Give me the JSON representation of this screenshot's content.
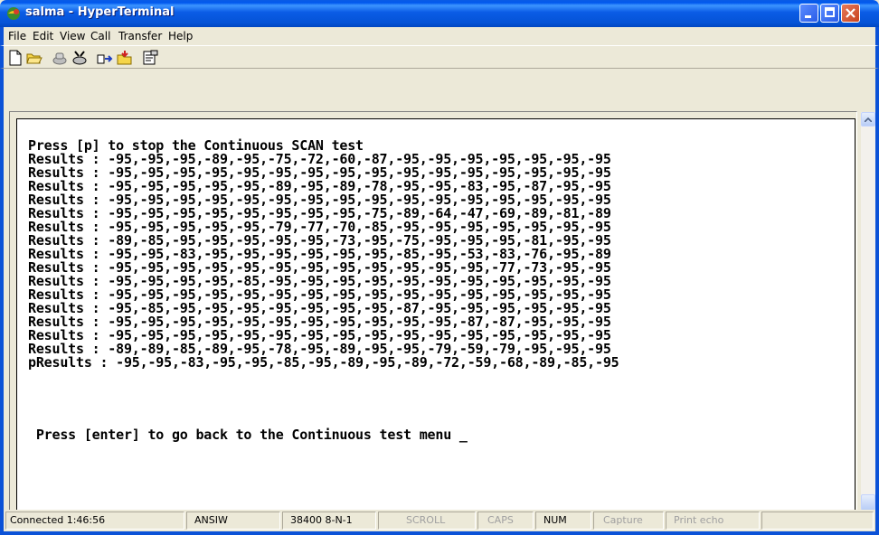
{
  "window": {
    "title": "salma - HyperTerminal"
  },
  "menu": [
    "File",
    "Edit",
    "View",
    "Call",
    "Transfer",
    "Help"
  ],
  "toolbar": {
    "icons": [
      "new-connection-icon",
      "open-icon",
      "call-icon",
      "disconnect-icon",
      "send-icon",
      "receive-icon",
      "properties-icon"
    ]
  },
  "terminal": {
    "lines": [
      "Press [p] to stop the Continuous SCAN test",
      "Results : -95,-95,-95,-89,-95,-75,-72,-60,-87,-95,-95,-95,-95,-95,-95,-95",
      "Results : -95,-95,-95,-95,-95,-95,-95,-95,-95,-95,-95,-95,-95,-95,-95,-95",
      "Results : -95,-95,-95,-95,-95,-89,-95,-89,-78,-95,-95,-83,-95,-87,-95,-95",
      "Results : -95,-95,-95,-95,-95,-95,-95,-95,-95,-95,-95,-95,-95,-95,-95,-95",
      "Results : -95,-95,-95,-95,-95,-95,-95,-95,-75,-89,-64,-47,-69,-89,-81,-89",
      "Results : -95,-95,-95,-95,-95,-79,-77,-70,-85,-95,-95,-95,-95,-95,-95,-95",
      "Results : -89,-85,-95,-95,-95,-95,-95,-73,-95,-75,-95,-95,-95,-81,-95,-95",
      "Results : -95,-95,-83,-95,-95,-95,-95,-95,-95,-85,-95,-53,-83,-76,-95,-89",
      "Results : -95,-95,-95,-95,-95,-95,-95,-95,-95,-95,-95,-95,-77,-73,-95,-95",
      "Results : -95,-95,-95,-95,-85,-95,-95,-95,-95,-95,-95,-95,-95,-95,-95,-95",
      "Results : -95,-95,-95,-95,-95,-95,-95,-95,-95,-95,-95,-95,-95,-95,-95,-95",
      "Results : -95,-85,-95,-95,-95,-95,-95,-95,-95,-87,-95,-95,-95,-95,-95,-95",
      "Results : -95,-95,-95,-95,-95,-95,-95,-95,-95,-95,-95,-87,-87,-95,-95,-95",
      "Results : -95,-95,-95,-95,-95,-95,-95,-95,-95,-95,-95,-95,-95,-95,-95,-95",
      "Results : -89,-89,-85,-89,-95,-78,-95,-89,-95,-95,-79,-59,-79,-95,-95,-95",
      "pResults : -95,-95,-83,-95,-95,-85,-95,-89,-95,-89,-72,-59,-68,-89,-85,-95",
      "",
      "",
      " Press [enter] to go back to the Continuous test menu _"
    ]
  },
  "status": {
    "connected": "Connected 1:46:56",
    "emulation": "ANSIW",
    "port_settings": "38400 8-N-1",
    "scroll": "SCROLL",
    "caps": "CAPS",
    "num": "NUM",
    "capture": "Capture",
    "print_echo": "Print echo"
  },
  "colors": {
    "titlebar": "#0a5ce6",
    "frame": "#0b52d7",
    "chrome": "#ece9d8"
  }
}
